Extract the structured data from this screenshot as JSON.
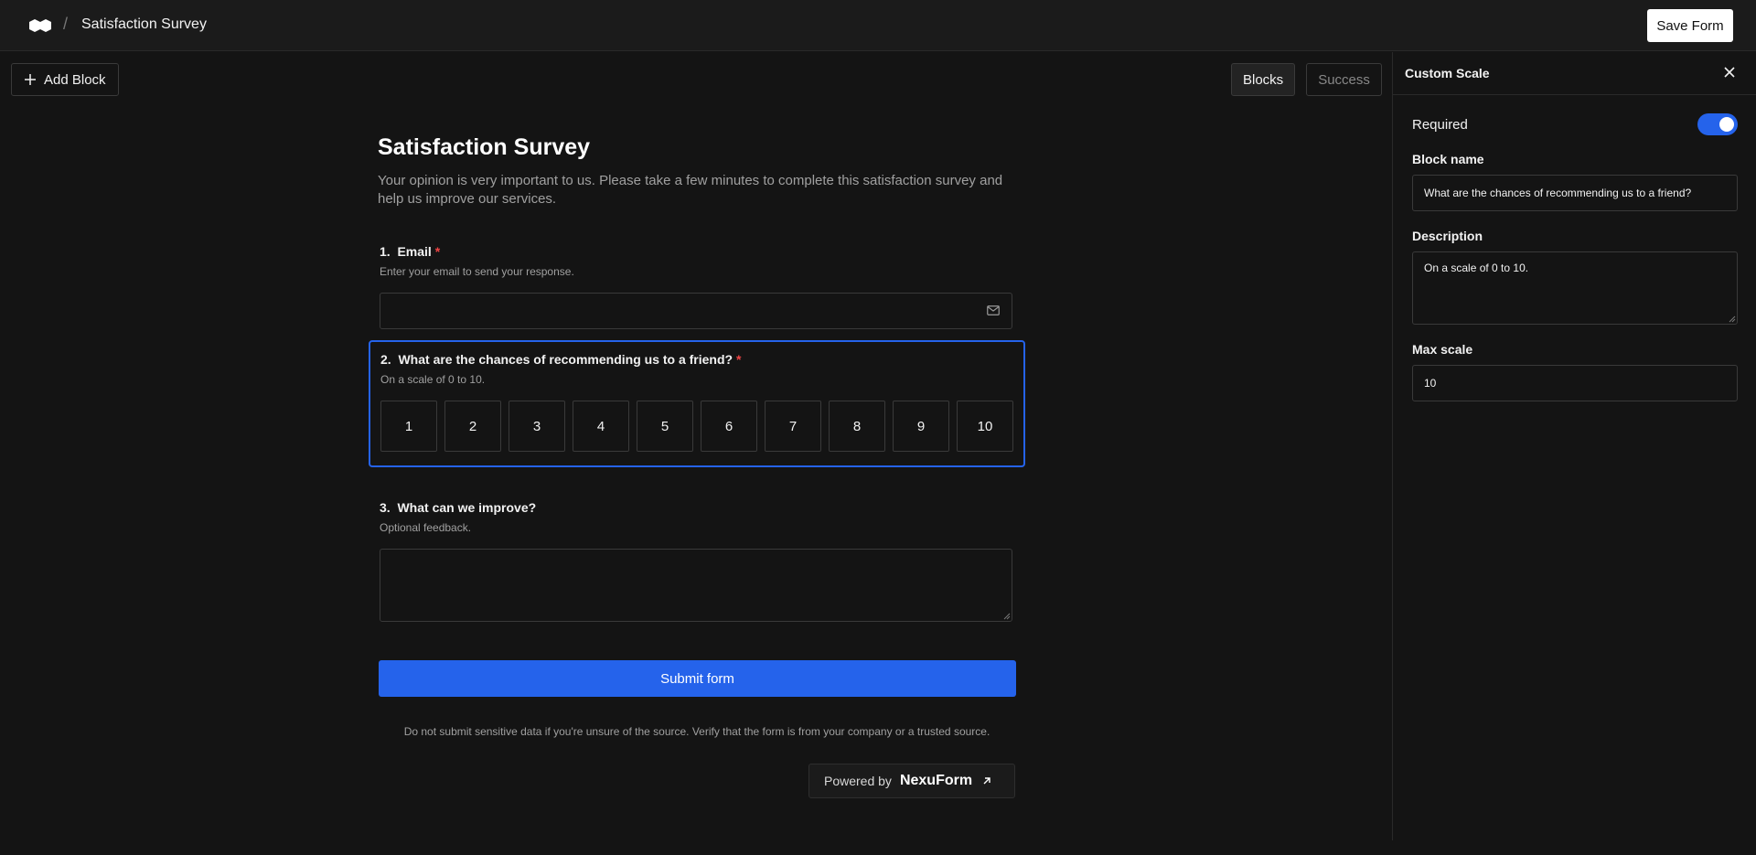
{
  "header": {
    "breadcrumb_title": "Satisfaction Survey",
    "save_label": "Save Form"
  },
  "toolbar": {
    "add_block_label": "Add Block",
    "tabs": [
      {
        "label": "Blocks",
        "active": true
      },
      {
        "label": "Success",
        "active": false
      }
    ]
  },
  "form": {
    "title": "Satisfaction Survey",
    "description": "Your opinion is very important to us. Please take a few minutes to complete this satisfaction survey and help us improve our services.",
    "questions": [
      {
        "number": "1.",
        "label": "Email",
        "required": true,
        "description": "Enter your email to send your response.",
        "value": ""
      },
      {
        "number": "2.",
        "label": "What are the chances of recommending us to a friend?",
        "required": true,
        "description": "On a scale of 0 to 10.",
        "scale": [
          "1",
          "2",
          "3",
          "4",
          "5",
          "6",
          "7",
          "8",
          "9",
          "10"
        ]
      },
      {
        "number": "3.",
        "label": "What can we improve?",
        "required": false,
        "description": "Optional feedback.",
        "value": ""
      }
    ],
    "required_marker": "*",
    "submit_label": "Submit form",
    "disclaimer": "Do not submit sensitive data if you're unsure of the source. Verify that the form is from your company or a trusted source.",
    "powered_by": {
      "prefix": "Powered by",
      "brand": "NexuForm"
    }
  },
  "panel": {
    "title": "Custom Scale",
    "required_label": "Required",
    "required_on": true,
    "block_name_label": "Block name",
    "block_name_value": "What are the chances of recommending us to a friend?",
    "description_label": "Description",
    "description_value": "On a scale of 0 to 10.",
    "max_scale_label": "Max scale",
    "max_scale_value": "10"
  },
  "colors": {
    "accent": "#2563eb",
    "required": "#ef4444",
    "background": "#141414"
  },
  "icons": [
    "logo-icon",
    "plus-icon",
    "mail-icon",
    "external-arrow-icon",
    "close-icon"
  ]
}
